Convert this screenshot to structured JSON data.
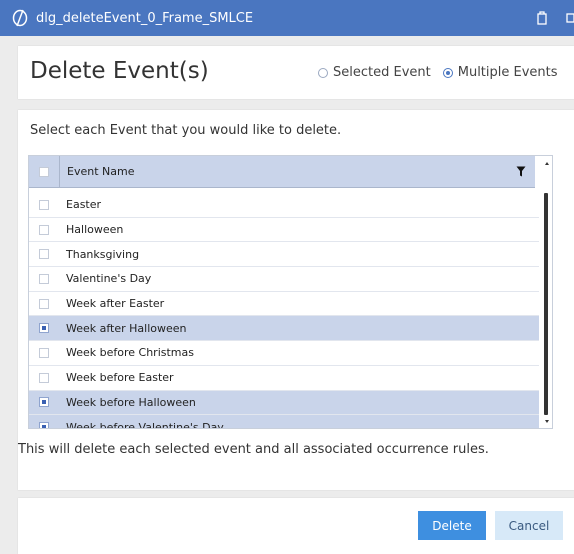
{
  "window": {
    "title": "dlg_deleteEvent_0_Frame_SMLCE"
  },
  "dialog": {
    "title": "Delete Event(s)",
    "radio_options": [
      {
        "label": "Selected Event",
        "checked": false
      },
      {
        "label": "Multiple Events",
        "checked": true
      }
    ],
    "instruction": "Select each Event that you would like to delete.",
    "footnote": "This will delete each selected event and all associated occurrence rules."
  },
  "grid": {
    "column_header": "Event Name",
    "rows": [
      {
        "name": "Easter",
        "checked": false
      },
      {
        "name": "Halloween",
        "checked": false
      },
      {
        "name": "Thanksgiving",
        "checked": false
      },
      {
        "name": "Valentine's Day",
        "checked": false
      },
      {
        "name": "Week after Easter",
        "checked": false
      },
      {
        "name": "Week after Halloween",
        "checked": true
      },
      {
        "name": "Week before Christmas",
        "checked": false
      },
      {
        "name": "Week before Easter",
        "checked": false
      },
      {
        "name": "Week before Halloween",
        "checked": true
      },
      {
        "name": "Week before Valentine's Day",
        "checked": true
      }
    ]
  },
  "buttons": {
    "delete": "Delete",
    "cancel": "Cancel"
  },
  "colors": {
    "titlebar": "#4a76c0",
    "selected_row": "#c9d4ea",
    "primary_button": "#3e8fe0",
    "secondary_button": "#d7e9f8"
  }
}
